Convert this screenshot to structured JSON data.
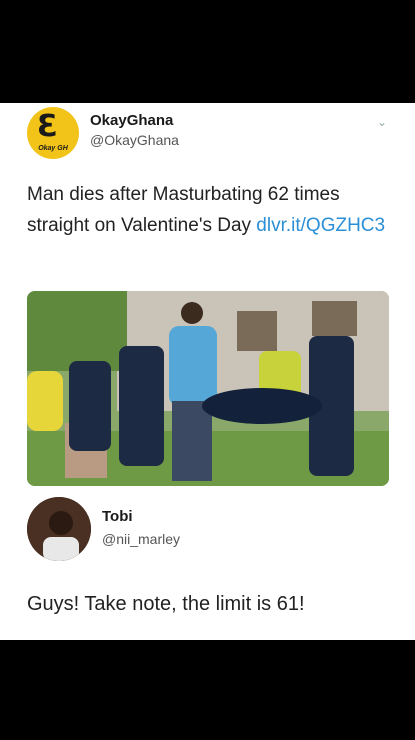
{
  "post": {
    "account_name": "OkayGhana",
    "account_handle": "@OkayGhana",
    "logo_glyph": "Ɛ",
    "logo_tag": "Okay GH",
    "text": "Man dies after Masturbating 62 times straight on Valentine's Day",
    "link": "dlvr.it/QGZHC3",
    "chevron_icon": "chevron-down"
  },
  "reply": {
    "account_name": "Tobi",
    "account_handle": "@nii_marley",
    "text": "Guys! Take note, the limit is 61!"
  },
  "colors": {
    "link": "#2a8fd6",
    "logo_bg": "#f2c318",
    "frame": "#000000"
  }
}
